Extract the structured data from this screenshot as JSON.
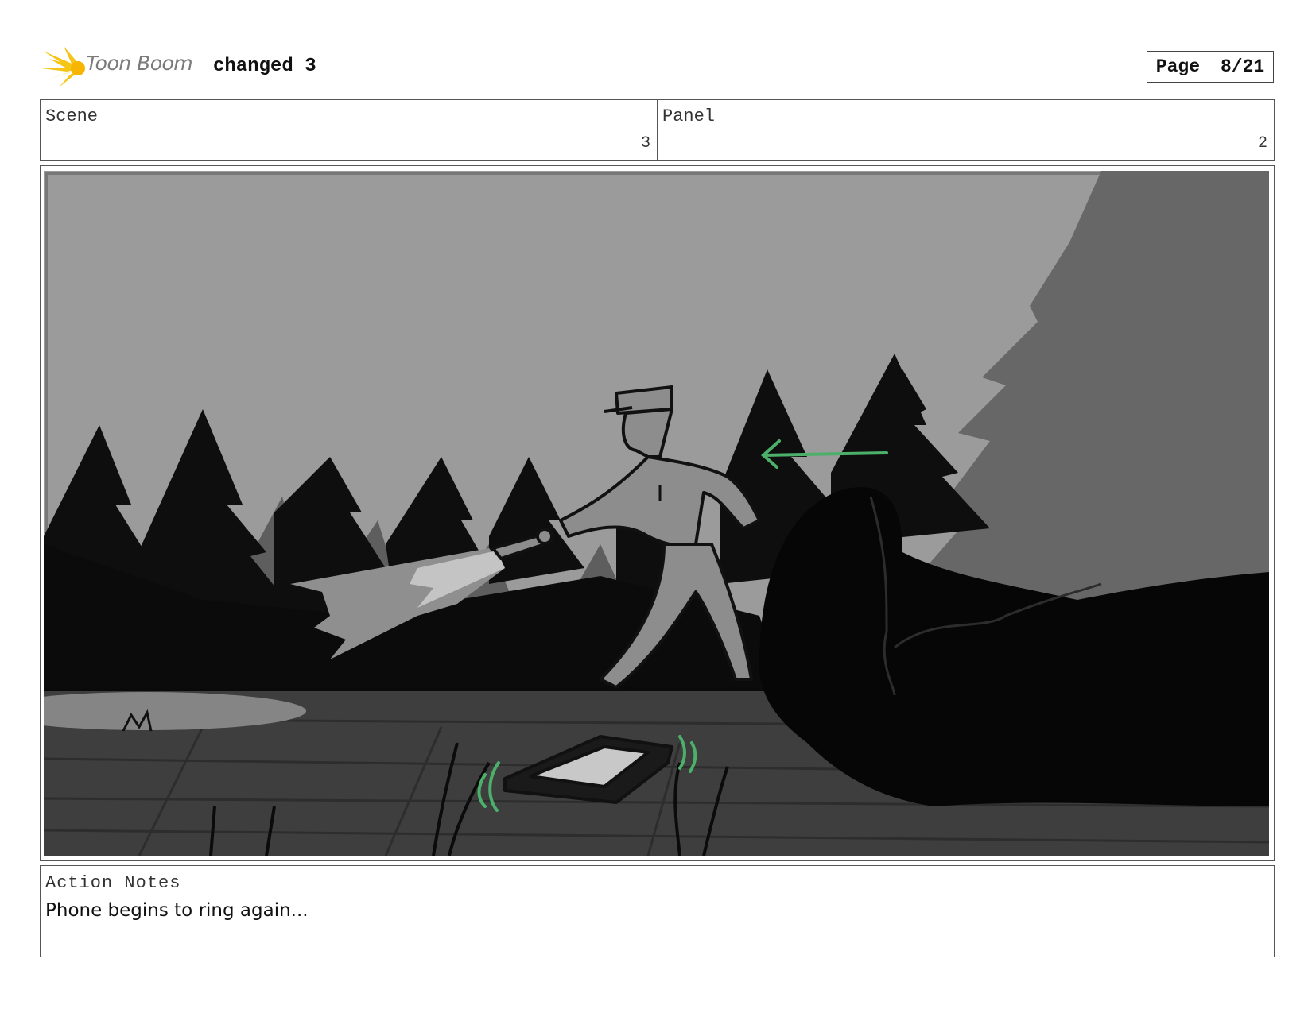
{
  "header": {
    "logo_text": "Toon Boom",
    "board_title": "changed 3",
    "page_label": "Page",
    "page_value": "8/21"
  },
  "info": {
    "scene_label": "Scene",
    "scene_value": "3",
    "panel_label": "Panel",
    "panel_value": "2"
  },
  "panel_image": {
    "icon": "storyboard-panel-image",
    "accent_color": "#4caf6a"
  },
  "notes": {
    "label": "Action Notes",
    "text": "Phone begins to ring again..."
  }
}
